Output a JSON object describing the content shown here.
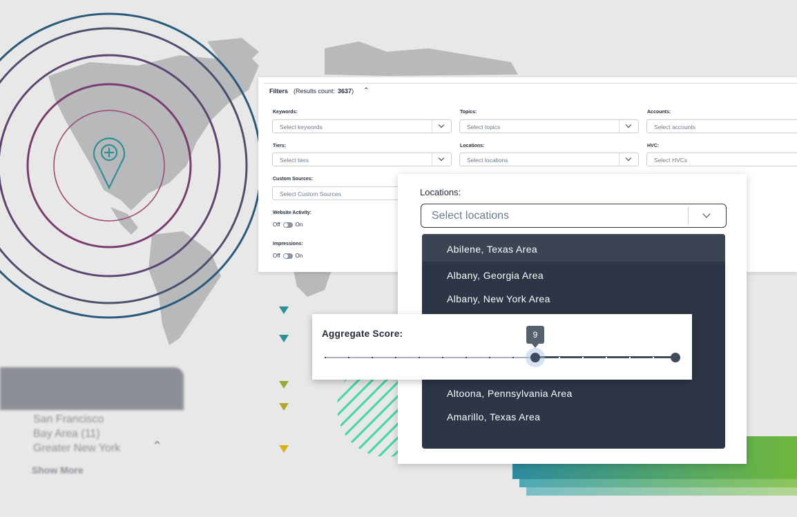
{
  "filters": {
    "title": "Filters",
    "results_prefix": "(Results count:",
    "results_count": "3637",
    "results_suffix": ")",
    "fields": {
      "keywords": {
        "label": "Keywords:",
        "placeholder": "Select keywords"
      },
      "topics": {
        "label": "Topics:",
        "placeholder": "Select topics"
      },
      "accounts": {
        "label": "Accounts:",
        "placeholder": "Select accounts"
      },
      "tiers": {
        "label": "Tiers:",
        "placeholder": "Select tiers"
      },
      "locations": {
        "label": "Locations:",
        "placeholder": "Select locations"
      },
      "hvc": {
        "label": "HVC:",
        "placeholder": "Select HVCs"
      },
      "custom_sources": {
        "label": "Custom Sources:",
        "placeholder": "Select Custom Sources"
      }
    },
    "website_activity": {
      "label": "Website Activity:",
      "off": "Off",
      "on": "On"
    },
    "impressions": {
      "label": "Impressions:",
      "off": "Off",
      "on": "On"
    }
  },
  "locations_popup": {
    "label": "Locations:",
    "placeholder": "Select locations",
    "items": [
      "Abilene, Texas Area",
      "Albany, Georgia Area",
      "Albany, New York Area",
      "Altoona, Pennsylvania Area",
      "Amarillo, Texas Area"
    ]
  },
  "aggregate_score": {
    "label": "Aggregate Score:",
    "value": "9",
    "value_fraction": 0.6
  },
  "blurred_card": {
    "line1": "San Francisco",
    "line2": "Bay Area (11)",
    "line3": "Greater New York",
    "show_more": "Show More"
  },
  "colors": {
    "dark_navy": "#2c3646",
    "teal": "#2f8f96",
    "olive": "#9aa83a",
    "gold": "#d4b21c",
    "mint": "#3fd6a8",
    "ring_blue": "#2a5a7a",
    "ring_purple": "#8a3a6a"
  }
}
